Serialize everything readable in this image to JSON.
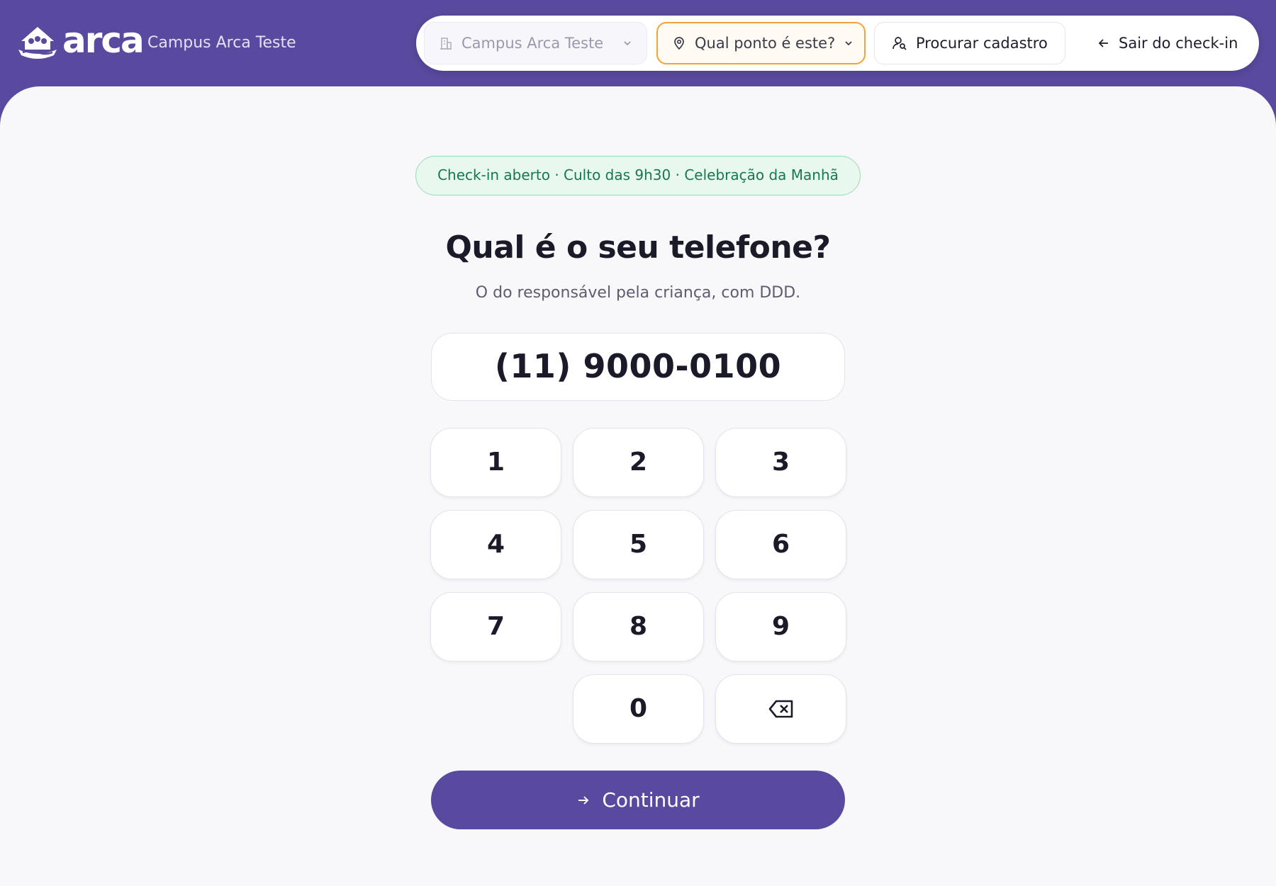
{
  "header": {
    "logo_text": "arca",
    "campus_name": "Campus Arca Teste"
  },
  "toolbar": {
    "campus_select": {
      "value": "Campus Arca Teste",
      "icon": "building-icon"
    },
    "point_select": {
      "value": "Qual ponto é este?",
      "icon": "map-pin-icon"
    },
    "search_button": {
      "label": "Procurar cadastro",
      "icon": "user-search-icon"
    },
    "exit_button": {
      "label": "Sair do check-in",
      "icon": "arrow-left-icon"
    }
  },
  "main": {
    "status_pill": "Check-in aberto · Culto das 9h30 · Celebração da Manhã",
    "heading": "Qual é o seu telefone?",
    "subheading": "O do responsável pela criança, com DDD.",
    "phone_value": "(11) 9000-0100",
    "keypad": {
      "keys": [
        "1",
        "2",
        "3",
        "4",
        "5",
        "6",
        "7",
        "8",
        "9",
        "0"
      ],
      "backspace_icon": "backspace-icon"
    },
    "continue_label": "Continuar"
  },
  "colors": {
    "brand": "#5a4a9f",
    "accent_orange": "#f2a33a",
    "status_green": "#147a4e",
    "status_bg": "#e8f8ef"
  }
}
